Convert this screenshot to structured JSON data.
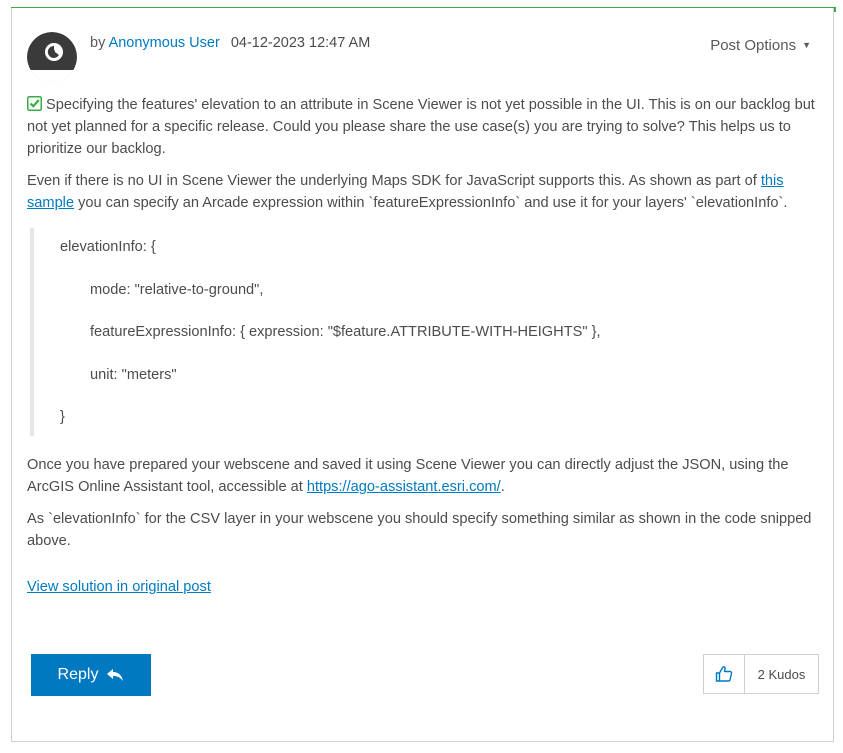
{
  "post": {
    "by": "by",
    "author": "Anonymous User",
    "date": "04-12-2023 12:47 AM",
    "options_label": "Post Options",
    "options_caret": "▼"
  },
  "body": {
    "p1": "Specifying the features' elevation to an attribute in Scene Viewer is not yet possible in the UI. This is on our backlog but not yet planned for a specific release. Could you please share the use case(s) you are trying to solve? This helps us to prioritize our backlog.",
    "p2_before": "Even if there is no UI in Scene Viewer the underlying Maps SDK for JavaScript supports this. As shown as part of ",
    "p2_link": "this sample",
    "p2_after": " you can specify an Arcade expression within `featureExpressionInfo` and use it for your layers' `elevationInfo`.",
    "code": {
      "line1": "elevationInfo: {",
      "line2": "mode: \"relative-to-ground\",",
      "line3": "featureExpressionInfo: { expression: \"$feature.ATTRIBUTE-WITH-HEIGHTS\" },",
      "line4": "unit: \"meters\"",
      "line5": "}"
    },
    "p3_before": "Once you have prepared your webscene and saved it using Scene Viewer you can directly adjust the JSON, using the ArcGIS Online Assistant tool, accessible at ",
    "p3_link": "https://ago-assistant.esri.com/",
    "p3_after": ".",
    "p4": "As `elevationInfo` for the CSV layer in your webscene you should specify something similar as shown in the code snipped above.",
    "view_solution": "View solution in original post"
  },
  "actions": {
    "reply_label": "Reply",
    "kudos_label": "2 Kudos"
  },
  "colors": {
    "accent_green": "#35ac46",
    "link_blue": "#007ac2",
    "reply_blue": "#0079c1"
  },
  "icons": {
    "avatar": "anonymous-avatar-icon",
    "check": "check-square-icon",
    "reply": "reply-arrow-icon",
    "thumb": "thumbs-up-icon"
  }
}
